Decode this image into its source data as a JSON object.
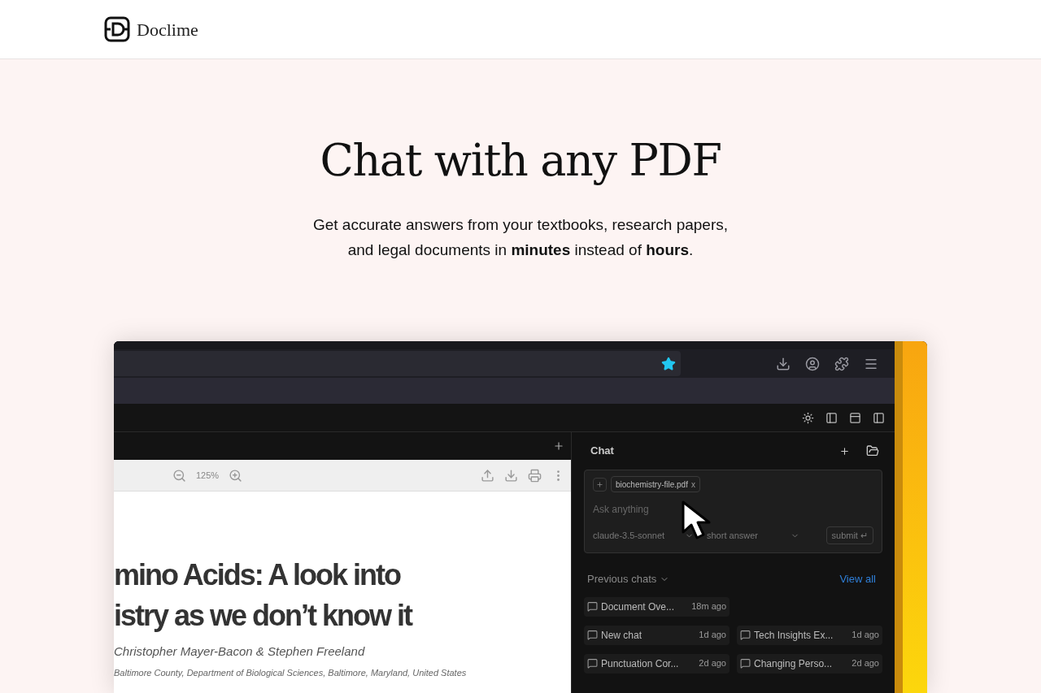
{
  "header": {
    "brand": "Doclime"
  },
  "hero": {
    "title": "Chat with any PDF",
    "subtitle": "Get accurate answers from your textbooks, research papers, and legal documents in **minutes** instead of **hours**."
  },
  "app_preview": {
    "pdf_viewer": {
      "zoom": "125%",
      "title_lines": [
        "mino Acids: A look into",
        "istry as we don’t know it"
      ],
      "authors": "Christopher Mayer-Bacon & Stephen Freeland",
      "affiliation": "Baltimore County, Department of Biological Sciences, Baltimore, Maryland, United States"
    },
    "chat": {
      "title": "Chat",
      "attachment": "biochemistry-file.pdf",
      "remove_glyph": "x",
      "placeholder": "Ask anything",
      "model": "claude-3.5-sonnet",
      "mode": "short answer",
      "submit": "submit",
      "submit_glyph": "↵",
      "previous_label": "Previous chats",
      "view_all": "View all",
      "previous_chats": [
        {
          "title": "Document Ove...",
          "time": "18m ago"
        },
        {
          "title": "New chat",
          "time": "1d ago"
        },
        {
          "title": "Tech Insights Ex...",
          "time": "1d ago"
        },
        {
          "title": "Punctuation Cor...",
          "time": "2d ago"
        },
        {
          "title": "Changing Perso...",
          "time": "2d ago"
        }
      ]
    }
  }
}
